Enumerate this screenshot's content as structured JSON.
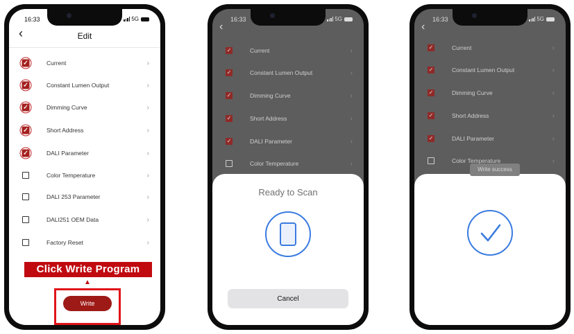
{
  "colors": {
    "accent_red": "#c00a10",
    "write_button": "#9e1a16",
    "scan_blue": "#3a7be0",
    "dim_overlay": "#5d5d5d"
  },
  "status": {
    "time": "16:33",
    "network": "5G"
  },
  "screen1": {
    "title": "Edit",
    "back_icon": "chevron-left-icon",
    "items": [
      {
        "label": "Current",
        "checked": true
      },
      {
        "label": "Constant Lumen Output",
        "checked": true
      },
      {
        "label": "Dimming Curve",
        "checked": true
      },
      {
        "label": "Short Address",
        "checked": true
      },
      {
        "label": "DALI Parameter",
        "checked": true
      },
      {
        "label": "Color Temperature",
        "checked": false
      },
      {
        "label": "DALI 253 Parameter",
        "checked": false
      },
      {
        "label": "DALI251 OEM Data",
        "checked": false
      },
      {
        "label": "Factory Reset",
        "checked": false
      }
    ],
    "annotation": "Click Write Program",
    "write_label": "Write"
  },
  "screen2": {
    "items": [
      {
        "label": "Current",
        "checked": true
      },
      {
        "label": "Constant Lumen Output",
        "checked": true
      },
      {
        "label": "Dimming Curve",
        "checked": true
      },
      {
        "label": "Short Address",
        "checked": true
      },
      {
        "label": "DALI Parameter",
        "checked": true
      },
      {
        "label": "Color Temperature",
        "checked": false
      }
    ],
    "sheet_title": "Ready to Scan",
    "scan_icon": "phone-scan-icon",
    "cancel_label": "Cancel"
  },
  "screen3": {
    "items": [
      {
        "label": "Current",
        "checked": true
      },
      {
        "label": "Constant Lumen Output",
        "checked": true
      },
      {
        "label": "Dimming Curve",
        "checked": true
      },
      {
        "label": "Short Address",
        "checked": true
      },
      {
        "label": "DALI Parameter",
        "checked": true
      },
      {
        "label": "Color Temperature",
        "checked": false
      }
    ],
    "toast": "Write success",
    "success_icon": "checkmark-circle-icon"
  }
}
